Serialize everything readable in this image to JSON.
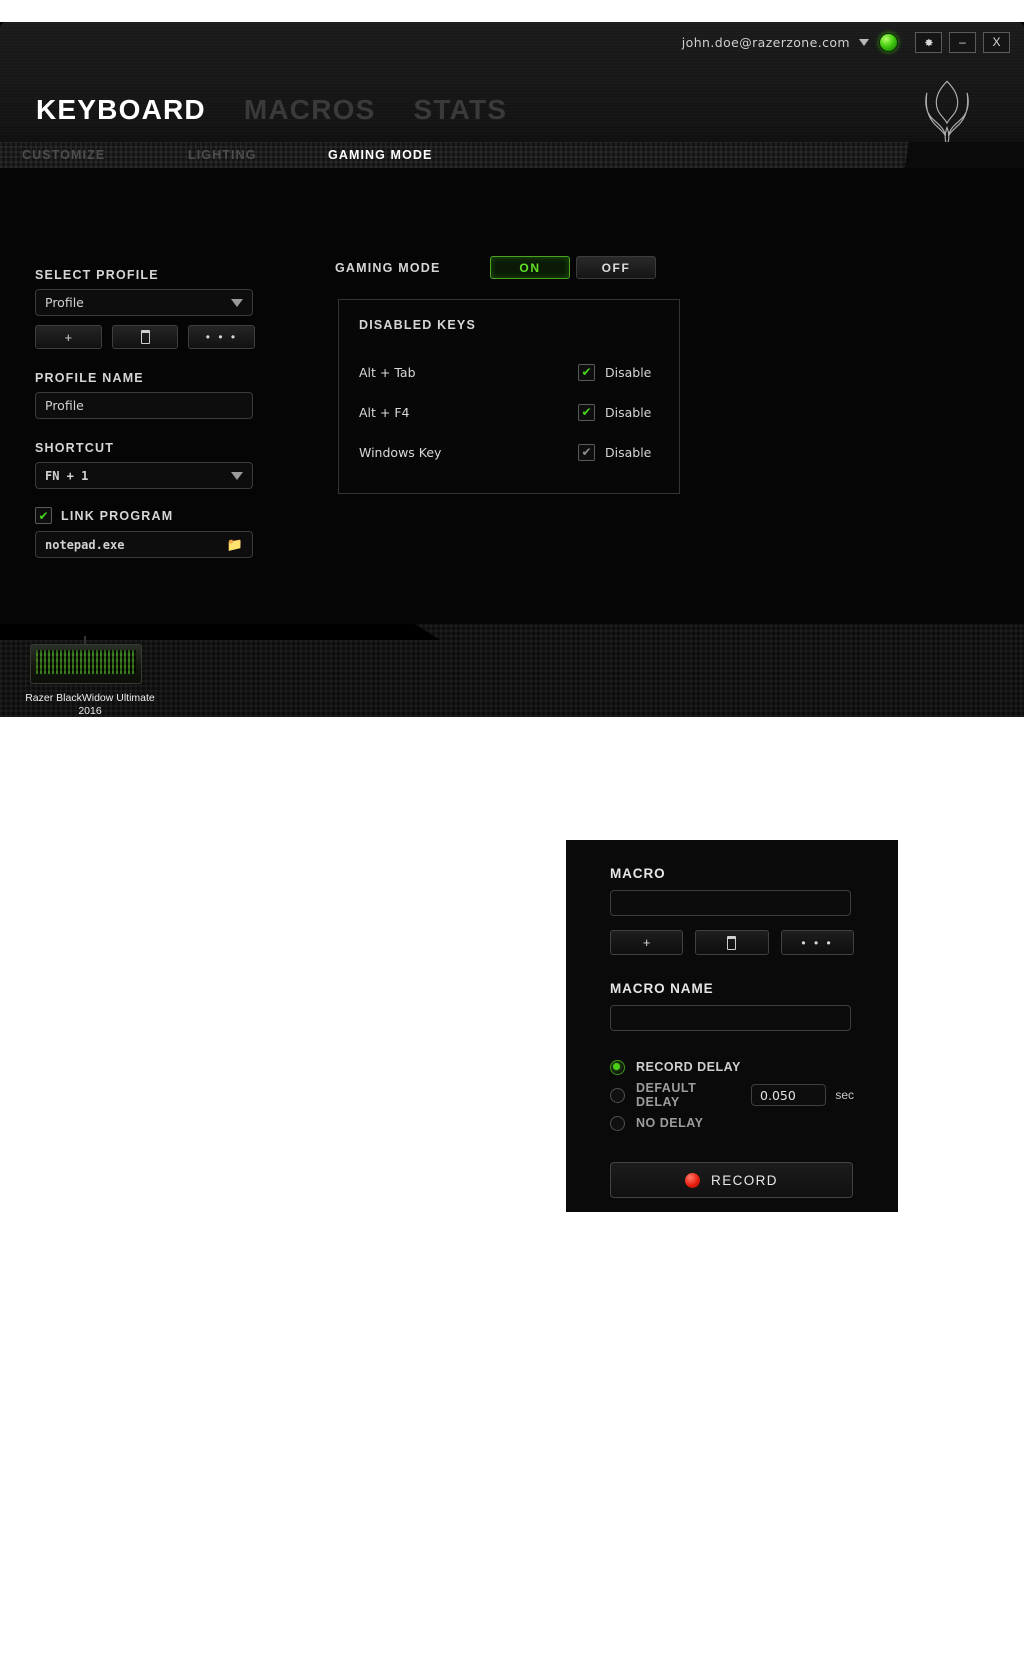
{
  "window": {
    "titlebar": {
      "account_email": "john.doe@razerzone.com",
      "dropdown_icon": "caret-down-icon",
      "status_icon": "online-status-orb",
      "settings_label": "⚙",
      "minimize_label": "–",
      "close_label": "X"
    },
    "main_nav": [
      {
        "label": "KEYBOARD",
        "active": true
      },
      {
        "label": "MACROS",
        "active": false
      },
      {
        "label": "STATS",
        "active": false
      }
    ],
    "sub_nav": [
      {
        "label": "CUSTOMIZE",
        "active": false
      },
      {
        "label": "LIGHTING",
        "active": false
      },
      {
        "label": "GAMING MODE",
        "active": true
      }
    ],
    "brand_logo": "razer-triple-snake-logo"
  },
  "left_panel": {
    "select_profile_label": "SELECT PROFILE",
    "select_profile_value": "Profile",
    "buttons": {
      "add_label": "+",
      "delete_label": "delete-icon",
      "more_label": "• • •"
    },
    "profile_name_label": "PROFILE NAME",
    "profile_name_value": "Profile",
    "shortcut_label": "SHORTCUT",
    "shortcut_value": "FN + 1",
    "link_program_label": "LINK PROGRAM",
    "link_program_checked": "✔",
    "program_path_value": "notepad.exe",
    "browse_icon": "folder-icon"
  },
  "gaming_mode": {
    "label": "GAMING MODE",
    "on_label": "ON",
    "off_label": "OFF",
    "active_state": "ON",
    "disabled_keys_title": "DISABLED KEYS",
    "keys": [
      {
        "name": "Alt + Tab",
        "action_label": "Disable",
        "checked": true,
        "check_glyph": "✔"
      },
      {
        "name": "Alt + F4",
        "action_label": "Disable",
        "checked": true,
        "check_glyph": "✔"
      },
      {
        "name": "Windows Key",
        "action_label": "Disable",
        "checked": false,
        "check_glyph": "✔"
      }
    ]
  },
  "device_bar": {
    "device_name_line1": "Razer BlackWidow Ultimate",
    "device_name_line2": "2016",
    "thumbnail_icon": "keyboard-thumbnail"
  },
  "macro_panel": {
    "macro_label": "MACRO",
    "macro_value": "",
    "buttons": {
      "add_label": "+",
      "delete_label": "delete-icon",
      "more_label": "• • •"
    },
    "macro_name_label": "MACRO NAME",
    "macro_name_value": "",
    "delay_options": [
      {
        "label": "RECORD DELAY",
        "selected": true
      },
      {
        "label": "DEFAULT DELAY",
        "selected": false
      },
      {
        "label": "NO DELAY",
        "selected": false
      }
    ],
    "default_delay_value": "0.050",
    "default_delay_unit": "sec",
    "record_button_label": "RECORD",
    "record_icon": "record-dot-icon"
  },
  "colors": {
    "razer_green": "#44cc11",
    "accent_green": "#5fe024",
    "record_red": "#e81f10",
    "panel_black": "#0a0a0a",
    "border_gray": "#3d3d3d"
  }
}
